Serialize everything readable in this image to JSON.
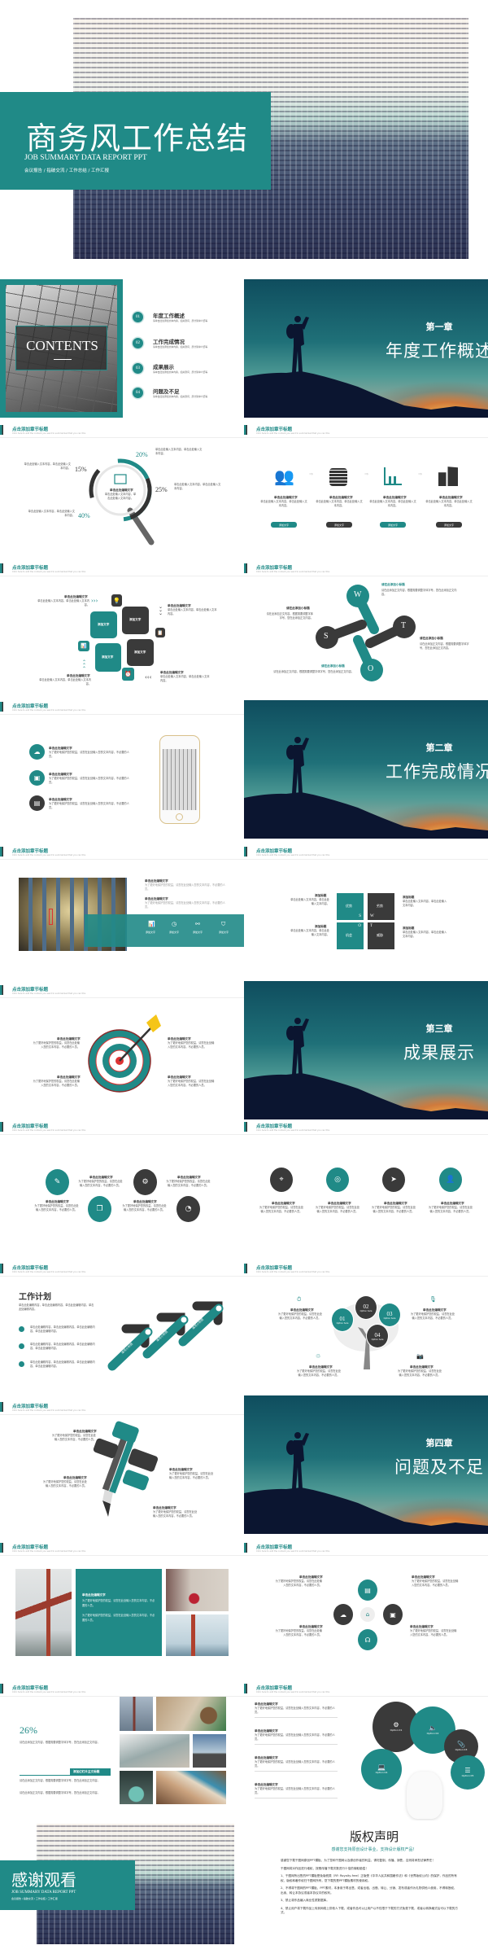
{
  "colors": {
    "accent": "#208a87",
    "dark": "#3a3a3a"
  },
  "cover": {
    "title": "商务风工作总结",
    "subtitle_en": "JOB SUMMARY DATA REPORT PPT",
    "subtitle_cn": "会议报告 / 指破交流 / 工作总结 / 工作汇报"
  },
  "header": {
    "title": "点击添加章节标题",
    "sub": "Click here to add the content you want to summarized that you can this"
  },
  "ph": {
    "title": "单击此处编辑文字",
    "text": "单击此处输入文本内容，单击此处输入文本内容。",
    "long": "为了更好地保护您的权益，请您在此处输入您的文本内容，不必要的人员。",
    "btn": "添加文字"
  },
  "contents": {
    "heading": "CONTENTS",
    "items": [
      {
        "num": "01",
        "label": "年度工作概述",
        "desc": "请单击此处添加文本内容，如关键词、部分简单介绍等"
      },
      {
        "num": "02",
        "label": "工作完成情况",
        "desc": "请单击此处添加文本内容，如关键词、部分简单介绍等"
      },
      {
        "num": "03",
        "label": "成果展示",
        "desc": "请单击此处添加文本内容，如关键词、部分简单介绍等"
      },
      {
        "num": "04",
        "label": "问题及不足",
        "desc": "请单击此处添加文本内容，如关键词、部分简单介绍等"
      }
    ]
  },
  "chapters": [
    {
      "num": "第一章",
      "title": "年度工作概述"
    },
    {
      "num": "第二章",
      "title": "工作完成情况"
    },
    {
      "num": "第三章",
      "title": "成果展示"
    },
    {
      "num": "第四章",
      "title": "问题及不足"
    }
  ],
  "magnifier": {
    "percents": [
      "20%",
      "15%",
      "25%",
      "40%"
    ],
    "center_title": "单击此处编辑文字"
  },
  "swot": {
    "letters": [
      "W",
      "S",
      "T",
      "O"
    ],
    "title": "请在此添加小标题",
    "text": "请在此添加正文内容，根据需要调整字体字号，您在此添加正文内容。"
  },
  "grid2x2": {
    "cells": [
      {
        "label": "优势",
        "letter": "S"
      },
      {
        "label": "劣势",
        "letter": "W"
      },
      {
        "label": "机会",
        "letter": "O"
      },
      {
        "label": "威胁",
        "letter": "T"
      }
    ],
    "side_title": "添加标题"
  },
  "plan": {
    "title": "工作计划",
    "text": "单击此处编辑内容，单击此处编辑内容，单击此处编辑内容，单击此处编辑内容。",
    "arrow_label": "填写小标题"
  },
  "tree": {
    "nums": [
      "01",
      "02",
      "03",
      "04"
    ],
    "option": "Option here"
  },
  "gallery": {
    "percent": "26%",
    "label": "添加幻灯片主文标题",
    "text": "请在此添加正文内容，根据需要调整字体字号，您在此添加正文内容。"
  },
  "bubbles": {
    "options": [
      "Option 01",
      "Option 02",
      "Option 03",
      "Option 04",
      "Option 05"
    ]
  },
  "thanks": {
    "title": "感谢观看",
    "subtitle_en": "JOB SUMMARY DATA REPORT PPT",
    "subtitle_cn": "会议报告 / 指破交流 / 工作总结 / 工作汇报"
  },
  "copyright": {
    "title": "版权声明",
    "subtitle": "感谢您支持原创设计事业，支持设计版权产品！",
    "paragraphs": [
      "感谢您下载千图网原创PPT模板，为了您和千图网以及原创作者的利益，请勿复制、传播、销售，否则将承担法律责任！",
      "千图网将对作品进行维权，按照传播下载次数进行十倍的索取赔偿！",
      "1、千图网所出售的PPT模板是免版税类（RF: Royalty-free）正版受《中华人民共和国著作法》和《世界版权公约》的保护，作品的所有权、版权和著作权归千图网所有，您下载的是PPT模板素材的使用权。",
      "2、不得将千图网的PPT模板、PPT素材，本身用于再出售，或者出租、出借、转让、分销、发布或者作为礼物供他人使用，不得转授权、出卖、转让本协议或者本协议中的权利。",
      "3、禁止将作品编入商业性质数据库。",
      "4、禁止用户将下载作品上传到网络上供他人下载，或者作品可以让用户以不仅限于下载的方式免费下载，或者以转换格式后可以下载的方式。"
    ]
  }
}
